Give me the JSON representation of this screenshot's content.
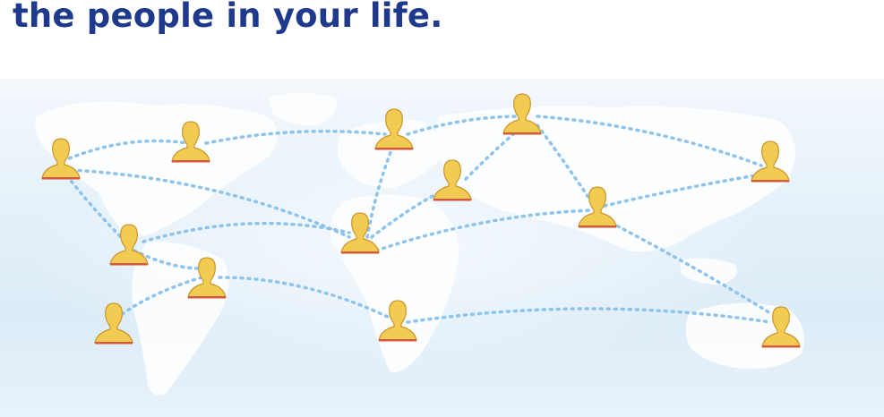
{
  "tagline": "the people in your life.",
  "colors": {
    "tagline": "#1f3a8c",
    "person_fill": "#f3cb52",
    "person_stroke": "#c9962b",
    "person_base": "#d45a3a",
    "connection": "#8ec3ee",
    "land": "#ffffff",
    "ocean": "#dcebf7"
  },
  "icons": {
    "person": "person-silhouette-icon"
  }
}
